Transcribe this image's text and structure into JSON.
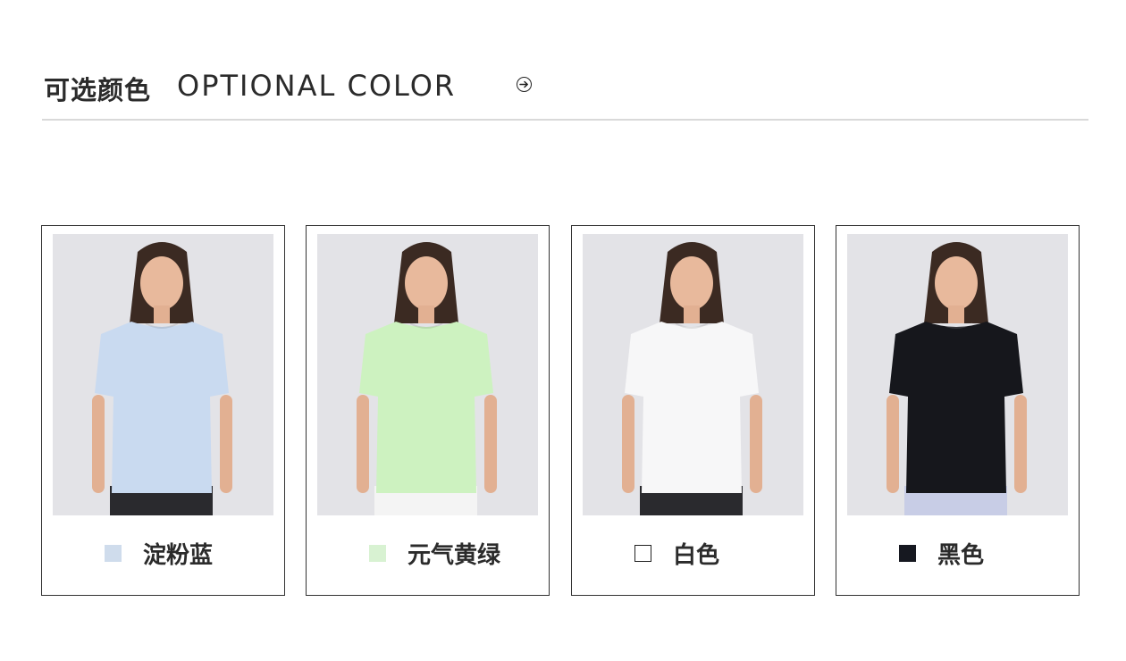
{
  "header": {
    "title_cn": "可选颜色",
    "title_en": "OPTIONAL COLOR",
    "arrow_icon": "circle-arrow-right-icon"
  },
  "colors": [
    {
      "name": "淀粉蓝",
      "swatch": "#cfdcec",
      "shirt": "#c9daf0",
      "bottom": "#2a2a2e"
    },
    {
      "name": "元气黄绿",
      "swatch": "#d8f2d2",
      "shirt": "#cdf2c0",
      "bottom": "#f4f4f4"
    },
    {
      "name": "白色",
      "swatch": "#ffffff",
      "shirt": "#f7f7f8",
      "bottom": "#2a2a2e"
    },
    {
      "name": "黑色",
      "swatch": "#161820",
      "shirt": "#16171c",
      "bottom": "#c8cde6"
    }
  ]
}
